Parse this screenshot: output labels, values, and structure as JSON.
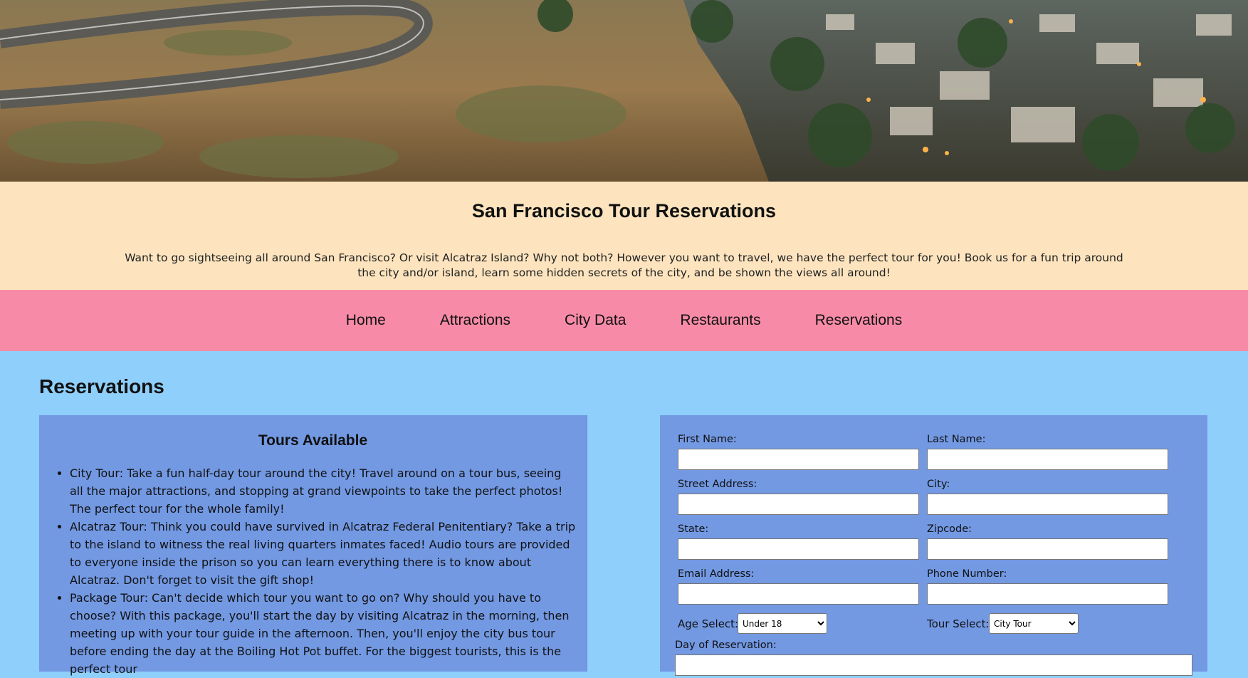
{
  "header": {
    "title": "San Francisco Tour Reservations",
    "intro": "Want to go sightseeing all around San Francisco? Or visit Alcatraz Island? Why not both? However you want to travel, we have the perfect tour for you! Book us for a fun trip around the city and/or island, learn some hidden secrets of the city, and be shown the views all around!"
  },
  "nav": {
    "items": [
      "Home",
      "Attractions",
      "City Data",
      "Restaurants",
      "Reservations"
    ]
  },
  "main": {
    "heading": "Reservations",
    "tours": {
      "title": "Tours Available",
      "items": [
        "City Tour: Take a fun half-day tour around the city! Travel around on a tour bus, seeing all the major attractions, and stopping at grand viewpoints to take the perfect photos! The perfect tour for the whole family!",
        "Alcatraz Tour: Think you could have survived in Alcatraz Federal Penitentiary? Take a trip to the island to witness the real living quarters inmates faced! Audio tours are provided to everyone inside the prison so you can learn everything there is to know about Alcatraz. Don't forget to visit the gift shop!",
        "Package Tour: Can't decide which tour you want to go on? Why should you have to choose? With this package, you'll start the day by visiting Alcatraz in the morning, then meeting up with your tour guide in the afternoon. Then, you'll enjoy the city bus tour before ending the day at the Boiling Hot Pot buffet. For the biggest tourists, this is the perfect tour"
      ]
    },
    "form": {
      "first_name": "First Name:",
      "last_name": "Last Name:",
      "street": "Street Address:",
      "city": "City:",
      "state": "State:",
      "zipcode": "Zipcode:",
      "email": "Email Address:",
      "phone": "Phone Number:",
      "age_label": "Age Select:",
      "age_value": "Under 18",
      "tour_label": "Tour Select:",
      "tour_value": "City Tour",
      "day_label": "Day of Reservation:"
    }
  },
  "colors": {
    "header_bg": "#fde4bf",
    "nav_bg": "#f78ba7",
    "page_bg": "#8ecffb",
    "panel_bg": "#7399e3"
  }
}
